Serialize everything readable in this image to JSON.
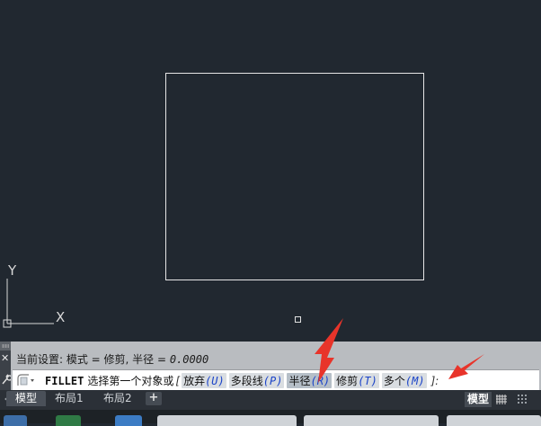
{
  "history": {
    "text": "当前设置: 模式 = 修剪, 半径 = ",
    "radius_value": "0.0000"
  },
  "command_line": {
    "command_name": "FILLET",
    "prompt": "选择第一个对象或",
    "bracket_open": "[",
    "options": [
      {
        "label": "放弃",
        "key": "(U)"
      },
      {
        "label": "多段线",
        "key": "(P)"
      },
      {
        "label": "半径",
        "key": "(R)"
      },
      {
        "label": "修剪",
        "key": "(T)"
      },
      {
        "label": "多个",
        "key": "(M)"
      }
    ],
    "bracket_close": "]:"
  },
  "ucs": {
    "x_label": "X",
    "y_label": "Y"
  },
  "side_controls": {
    "close_label": "✕"
  },
  "layout_tabs": [
    {
      "label": "模型"
    },
    {
      "label": "布局1"
    },
    {
      "label": "布局2"
    }
  ],
  "add_tab_label": "+",
  "status": {
    "model_label": "模型"
  },
  "colors": {
    "canvas": "#212830",
    "command_panel": "#b9bcc0",
    "option_key": "#1a43c8",
    "annotation_arrow": "#e8342a"
  },
  "icons": [
    "ucs-icon",
    "close-icon",
    "wrench-icon",
    "command-prompt-icon",
    "grid-icon",
    "snap-grid-icon"
  ]
}
